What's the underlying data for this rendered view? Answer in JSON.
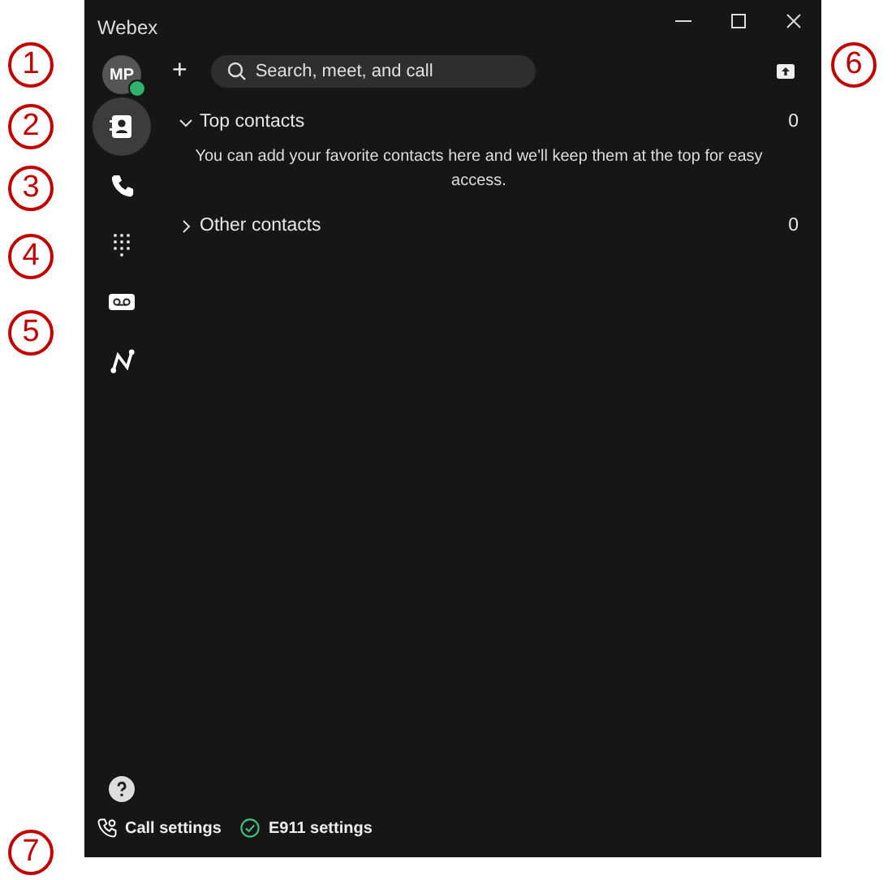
{
  "callouts": [
    "1",
    "6",
    "2",
    "3",
    "4",
    "5",
    "7"
  ],
  "window": {
    "title": "Webex"
  },
  "avatar": {
    "initials": "MP",
    "online": true
  },
  "new_button": "+",
  "search": {
    "placeholder": "Search, meet, and call"
  },
  "nav": [
    {
      "kind": "contacts",
      "selected": true
    },
    {
      "kind": "calls",
      "selected": false
    },
    {
      "kind": "dialpad",
      "selected": false
    },
    {
      "kind": "voicemail",
      "selected": false
    },
    {
      "kind": "analytics",
      "selected": false
    }
  ],
  "sections": [
    {
      "title": "Top contacts",
      "count": "0",
      "expanded": true,
      "message": "You can add your favorite contacts here and we'll keep them at the top for easy access."
    },
    {
      "title": "Other contacts",
      "count": "0",
      "expanded": false
    }
  ],
  "footer": [
    {
      "kind": "call-settings",
      "label": "Call settings"
    },
    {
      "kind": "e911",
      "label": "E911 settings"
    }
  ]
}
